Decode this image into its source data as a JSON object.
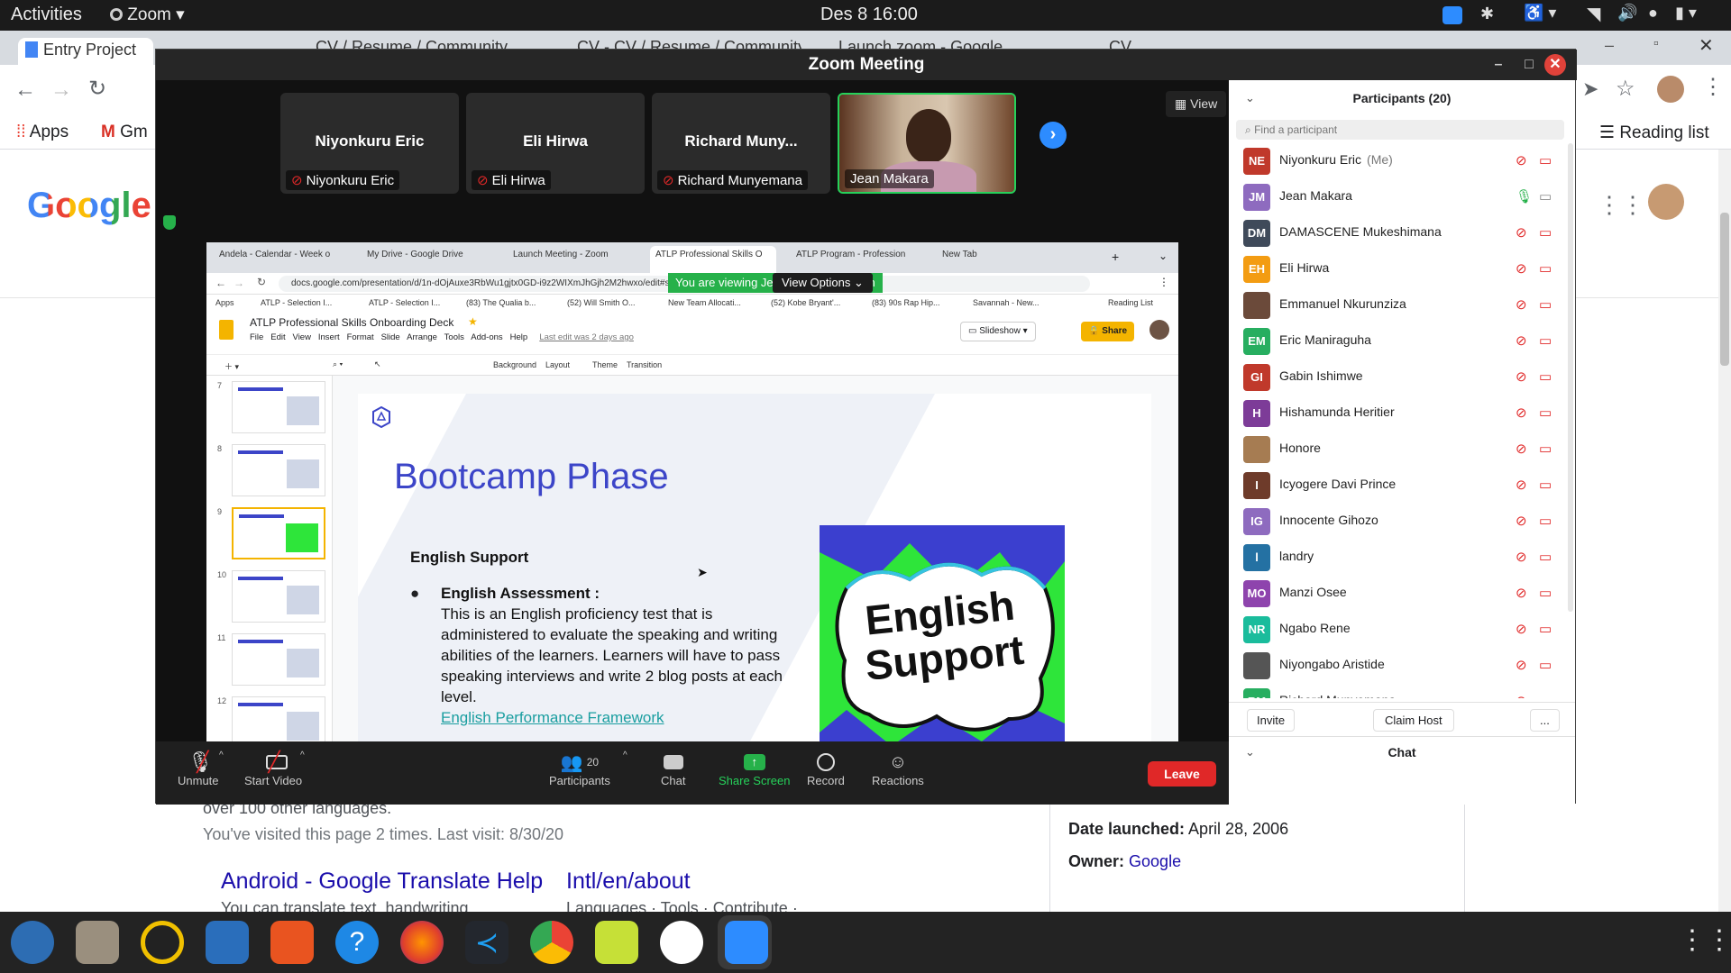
{
  "topbar": {
    "activities": "Activities",
    "app_name": "Zoom",
    "datetime": "Des 8  16:00"
  },
  "host_browser": {
    "tabs": [
      "Entry Project",
      "CV / Resume / Community",
      "CV - CV / Resume / Community",
      "Launch zoom - Google",
      "CV"
    ],
    "bookmarks": [
      "Apps",
      "Gm"
    ],
    "reading_list": "Reading list"
  },
  "google_page": {
    "logo_text": "Google",
    "snippet_top": "over 100 other languages.",
    "visited": "You've visited this page 2 times. Last visit: 8/30/20",
    "result_1": "Android - Google Translate Help",
    "result_1_sub": "You can translate text, handwriting,",
    "result_2": "Intl/en/about",
    "result_2_sub": "Languages · Tools · Contribute · ...",
    "kp_date_label": "Date launched:",
    "kp_date_value": "April 28, 2006",
    "kp_owner_label": "Owner:",
    "kp_owner_value": "Google"
  },
  "zoom": {
    "title": "Zoom Meeting",
    "view_button": "View",
    "tiles": [
      {
        "name": "Niyonkuru Eric",
        "label": "Niyonkuru Eric"
      },
      {
        "name": "Eli Hirwa",
        "label": "Eli Hirwa"
      },
      {
        "name": "Richard Muny...",
        "label": "Richard Munyemana"
      },
      {
        "name": "",
        "label": "Jean Makara"
      }
    ],
    "viewing_banner": "You are viewing Jean Makara's screen",
    "view_options": "View Options",
    "toolbar": {
      "unmute": "Unmute",
      "start_video": "Start Video",
      "participants_count": "20",
      "participants": "Participants",
      "chat": "Chat",
      "share_screen": "Share Screen",
      "record": "Record",
      "reactions": "Reactions",
      "leave": "Leave"
    },
    "panel": {
      "title": "Participants (20)",
      "search_placeholder": "Find a participant",
      "invite": "Invite",
      "claim_host": "Claim Host",
      "more": "...",
      "chat": "Chat",
      "participants": [
        {
          "initials": "NE",
          "name": "Niyonkuru Eric",
          "suffix": "(Me)",
          "color": "#c0392b",
          "audio": "muted"
        },
        {
          "initials": "JM",
          "name": "Jean Makara",
          "suffix": "",
          "color": "#8e6bbf",
          "audio": "on"
        },
        {
          "initials": "DM",
          "name": "DAMASCENE Mukeshimana",
          "suffix": "",
          "color": "#3f4a5a",
          "audio": "muted"
        },
        {
          "initials": "EH",
          "name": "Eli Hirwa",
          "suffix": "",
          "color": "#f39c12",
          "audio": "muted"
        },
        {
          "initials": "",
          "name": "Emmanuel Nkurunziza",
          "suffix": "",
          "color": "#6b4a3a",
          "audio": "muted"
        },
        {
          "initials": "EM",
          "name": "Eric Maniraguha",
          "suffix": "",
          "color": "#27ae60",
          "audio": "muted"
        },
        {
          "initials": "GI",
          "name": "Gabin Ishimwe",
          "suffix": "",
          "color": "#c0392b",
          "audio": "muted"
        },
        {
          "initials": "H",
          "name": "Hishamunda Heritier",
          "suffix": "",
          "color": "#7d3c98",
          "audio": "muted"
        },
        {
          "initials": "",
          "name": "Honore",
          "suffix": "",
          "color": "#a67c52",
          "audio": "muted"
        },
        {
          "initials": "I",
          "name": "Icyogere Davi Prince",
          "suffix": "",
          "color": "#6e3b2a",
          "audio": "muted"
        },
        {
          "initials": "IG",
          "name": "Innocente Gihozo",
          "suffix": "",
          "color": "#8e6bbf",
          "audio": "muted"
        },
        {
          "initials": "l",
          "name": "landry",
          "suffix": "",
          "color": "#2471a3",
          "audio": "muted"
        },
        {
          "initials": "MO",
          "name": "Manzi Osee",
          "suffix": "",
          "color": "#8e44ad",
          "audio": "muted"
        },
        {
          "initials": "NR",
          "name": "Ngabo Rene",
          "suffix": "",
          "color": "#1abc9c",
          "audio": "muted"
        },
        {
          "initials": "",
          "name": "Niyongabo Aristide",
          "suffix": "",
          "color": "#555555",
          "audio": "muted"
        },
        {
          "initials": "RM",
          "name": "Richard Munyemana",
          "suffix": "",
          "color": "#27ae60",
          "audio": "muted"
        }
      ]
    }
  },
  "shared_screen": {
    "tabs": [
      "Andela - Calendar - Week o",
      "My Drive - Google Drive",
      "Launch Meeting - Zoom",
      "ATLP Professional Skills O",
      "ATLP Program - Profession",
      "New Tab"
    ],
    "url": "docs.google.com/presentation/d/1n-dOjAuxe3RbWu1gjtx0GD-i9z2WIXmJhGjh2M2hwxo/edit#slide=id.ge1e9b79129_1_660",
    "bookmarks": [
      "Apps",
      "ATLP - Selection I...",
      "ATLP - Selection I...",
      "(83) The Qualia b...",
      "(52) Will Smith O...",
      "New Team Allocati...",
      "(52) Kobe Bryant'...",
      "(83) 90s Rap Hip...",
      "Savannah - New..."
    ],
    "reading_list": "Reading List",
    "doc_title": "ATLP Professional Skills Onboarding Deck",
    "menus": [
      "File",
      "Edit",
      "View",
      "Insert",
      "Format",
      "Slide",
      "Arrange",
      "Tools",
      "Add-ons",
      "Help"
    ],
    "last_edit": "Last edit was 2 days ago",
    "slideshow": "Slideshow",
    "share": "Share",
    "toolbar_items": [
      "Background",
      "Layout",
      "Theme",
      "Transition"
    ],
    "thumb_numbers": [
      "7",
      "8",
      "9",
      "10",
      "11",
      "12",
      "13"
    ],
    "slide": {
      "title": "Bootcamp Phase",
      "subtitle": "English Support",
      "bullet_head": "English Assessment :",
      "bullet_body": "This is an English proficiency test that is administered to evaluate the speaking and writing abilities of the learners. Learners will have to pass speaking interviews and write 2 blog posts  at  each level.",
      "link": "English Performance Framework",
      "image_text_1": "English",
      "image_text_2": "Support"
    }
  },
  "colors": {
    "zoom_dark": "#1a1a1a",
    "share_green": "#26b14a",
    "leave_red": "#e02828",
    "slide_title_blue": "#3c45c8",
    "google_link": "#1a0dab"
  }
}
